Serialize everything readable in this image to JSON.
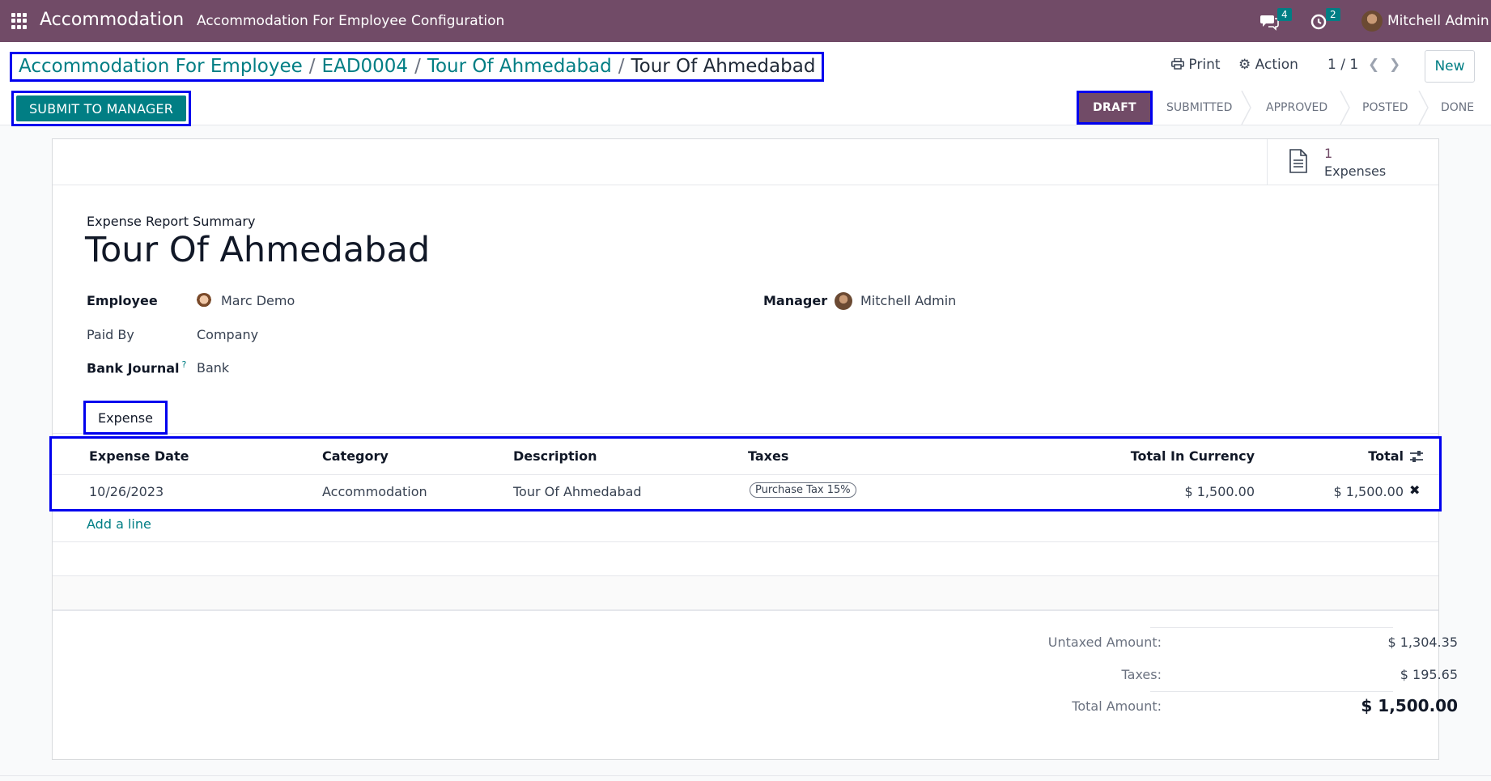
{
  "topbar": {
    "app_name": "Accommodation",
    "menu": [
      "Accommodation For Employee",
      "Configuration"
    ],
    "messages_count": "4",
    "activities_count": "2",
    "user_name": "Mitchell Admin"
  },
  "breadcrumb": {
    "items": [
      "Accommodation For Employee",
      "EAD0004",
      "Tour Of Ahmedabad"
    ],
    "current": "Tour Of Ahmedabad",
    "separator": "/"
  },
  "controls": {
    "print_label": "Print",
    "action_label": "Action",
    "pager": "1 / 1",
    "new_label": "New",
    "submit_label": "SUBMIT TO MANAGER"
  },
  "statusbar": [
    "DRAFT",
    "SUBMITTED",
    "APPROVED",
    "POSTED",
    "DONE"
  ],
  "stat_button": {
    "value": "1",
    "label": "Expenses"
  },
  "form": {
    "summary_label": "Expense Report Summary",
    "title": "Tour Of Ahmedabad",
    "employee_label": "Employee",
    "employee_value": "Marc Demo",
    "paid_by_label": "Paid By",
    "paid_by_value": "Company",
    "bank_journal_label": "Bank Journal",
    "bank_journal_help": "?",
    "bank_journal_value": "Bank",
    "manager_label": "Manager",
    "manager_value": "Mitchell Admin"
  },
  "tab": {
    "label": "Expense"
  },
  "table": {
    "headers": [
      "Expense Date",
      "Category",
      "Description",
      "Taxes",
      "Total In Currency",
      "Total"
    ],
    "rows": [
      {
        "date": "10/26/2023",
        "category": "Accommodation",
        "description": "Tour Of Ahmedabad",
        "taxes": "Purchase Tax 15%",
        "total_currency": "$ 1,500.00",
        "total": "$ 1,500.00"
      }
    ],
    "add_line": "Add a line"
  },
  "totals": {
    "untaxed_label": "Untaxed Amount:",
    "untaxed_value": "$ 1,304.35",
    "taxes_label": "Taxes:",
    "taxes_value": "$ 195.65",
    "total_label": "Total Amount:",
    "total_value": "$ 1,500.00"
  },
  "colors": {
    "brand": "#714b67",
    "accent": "#017e84",
    "highlight_box": "#0000ee"
  }
}
